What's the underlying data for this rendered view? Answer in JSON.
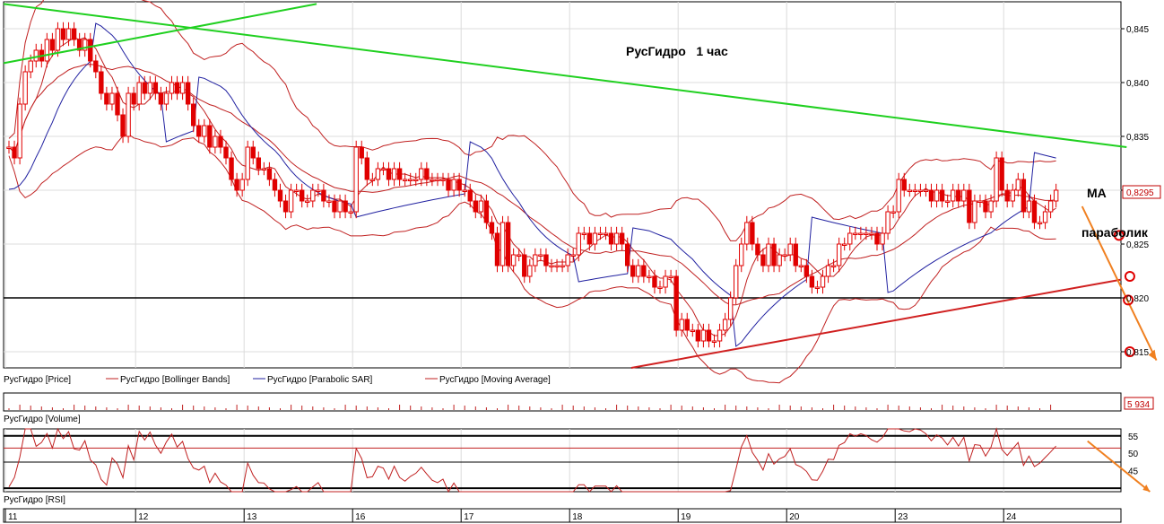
{
  "colors": {
    "candle": "#e00000",
    "bollinger": "#c02020",
    "psar": "#2020a0",
    "ma": "#c02020",
    "trend_green": "#20d020",
    "trend_red": "#d02020",
    "forecast_arrow": "#f08020",
    "grid": "#dcdcdc"
  },
  "chart_data": {
    "type": "line",
    "title": "РусГидро   1 час",
    "legend": [
      "РусГидро [Price]",
      "РусГидро [Bollinger Bands]",
      "РусГидро [Parabolic SAR]",
      "РусГидро [Moving Average]"
    ],
    "price_axis": {
      "ylim": [
        0.8135,
        0.8475
      ],
      "ticks": [
        "0,845",
        "0,840",
        "0,835",
        "0,830",
        "0,825",
        "0,820",
        "0,815"
      ]
    },
    "last_price_label": "0,8295",
    "dates": [
      {
        "label": "11",
        "bar": 0
      },
      {
        "label": "12",
        "bar": 24
      },
      {
        "label": "13",
        "bar": 44
      },
      {
        "label": "16",
        "bar": 64
      },
      {
        "label": "17",
        "bar": 84
      },
      {
        "label": "18",
        "bar": 104
      },
      {
        "label": "19",
        "bar": 124
      },
      {
        "label": "20",
        "bar": 144
      },
      {
        "label": "23",
        "bar": 164
      },
      {
        "label": "24",
        "bar": 184
      }
    ],
    "close": [
      0.834,
      0.833,
      0.838,
      0.841,
      0.842,
      0.843,
      0.842,
      0.844,
      0.843,
      0.845,
      0.844,
      0.845,
      0.844,
      0.843,
      0.844,
      0.842,
      0.841,
      0.839,
      0.838,
      0.839,
      0.837,
      0.835,
      0.839,
      0.838,
      0.84,
      0.839,
      0.84,
      0.839,
      0.838,
      0.839,
      0.84,
      0.839,
      0.84,
      0.838,
      0.836,
      0.835,
      0.836,
      0.834,
      0.835,
      0.834,
      0.833,
      0.831,
      0.83,
      0.831,
      0.834,
      0.833,
      0.832,
      0.832,
      0.831,
      0.83,
      0.829,
      0.828,
      0.83,
      0.83,
      0.829,
      0.829,
      0.83,
      0.83,
      0.829,
      0.829,
      0.828,
      0.829,
      0.828,
      0.828,
      0.834,
      0.833,
      0.831,
      0.831,
      0.832,
      0.832,
      0.831,
      0.832,
      0.831,
      0.831,
      0.831,
      0.831,
      0.832,
      0.831,
      0.831,
      0.831,
      0.831,
      0.83,
      0.831,
      0.83,
      0.83,
      0.829,
      0.828,
      0.829,
      0.827,
      0.826,
      0.823,
      0.827,
      0.823,
      0.824,
      0.824,
      0.822,
      0.823,
      0.824,
      0.824,
      0.823,
      0.823,
      0.823,
      0.823,
      0.824,
      0.824,
      0.826,
      0.826,
      0.825,
      0.826,
      0.826,
      0.826,
      0.825,
      0.826,
      0.825,
      0.823,
      0.822,
      0.823,
      0.822,
      0.822,
      0.821,
      0.821,
      0.822,
      0.822,
      0.817,
      0.818,
      0.817,
      0.817,
      0.816,
      0.817,
      0.816,
      0.816,
      0.817,
      0.818,
      0.82,
      0.823,
      0.825,
      0.827,
      0.825,
      0.824,
      0.823,
      0.825,
      0.823,
      0.824,
      0.824,
      0.825,
      0.823,
      0.823,
      0.822,
      0.821,
      0.821,
      0.822,
      0.823,
      0.823,
      0.825,
      0.825,
      0.826,
      0.826,
      0.826,
      0.826,
      0.826,
      0.825,
      0.826,
      0.828,
      0.828,
      0.831,
      0.83,
      0.83,
      0.83,
      0.83,
      0.83,
      0.829,
      0.83,
      0.829,
      0.829,
      0.83,
      0.829,
      0.83,
      0.827,
      0.829,
      0.829,
      0.828,
      0.829,
      0.833,
      0.83,
      0.829,
      0.83,
      0.831,
      0.828,
      0.829,
      0.827,
      0.827,
      0.828,
      0.829,
      0.83
    ],
    "rsi_axis": {
      "ylim": [
        39,
        57
      ],
      "ticks": [
        "55",
        "50",
        "45"
      ],
      "bands": [
        55,
        51.5,
        47.5,
        40
      ]
    },
    "rsi": [
      40.4,
      43.1,
      48.9,
      57.3,
      57.5,
      52.0,
      53.1,
      55.7,
      51.5,
      58.2,
      54.2,
      56.2,
      51.3,
      50.9,
      53.6,
      48.1,
      46.7,
      42.5,
      40.9,
      48.7,
      46.9,
      43.0,
      52.2,
      48.1,
      56.3,
      53.8,
      56.1,
      52.4,
      50.0,
      53.2,
      55.5,
      51.8,
      53.4,
      48.5,
      45.8,
      45.2,
      46.3,
      41.6,
      44.3,
      41.8,
      40.9,
      37.8,
      36.8,
      38.9,
      47.2,
      43.7,
      41.6,
      41.5,
      39.8,
      37.0,
      36.0,
      35.1,
      39.6,
      40.5,
      37.4,
      38.4,
      40.4,
      41.6,
      38.9,
      37.2,
      35.9,
      39.0,
      36.1,
      36.8,
      51.4,
      48.5,
      43.0,
      43.3,
      46.3,
      45.8,
      42.6,
      46.3,
      43.1,
      42.0,
      43.4,
      44.3,
      46.0,
      44.1,
      42.3,
      41.6,
      42.6,
      38.7,
      41.5,
      38.3,
      38.6,
      36.5,
      35.9,
      38.7,
      34.6,
      31.2,
      26.3,
      36.4,
      30.0,
      32.0,
      32.0,
      29.5,
      32.1,
      33.8,
      34.3,
      31.6,
      31.6,
      32.1,
      33.6,
      36.0,
      36.4,
      41.0,
      41.0,
      38.3,
      40.6,
      40.6,
      40.6,
      37.9,
      40.7,
      39.0,
      34.7,
      32.1,
      35.0,
      32.2,
      33.2,
      30.8,
      31.7,
      33.3,
      33.9,
      25.7,
      28.6,
      27.1,
      27.6,
      26.3,
      28.4,
      27.1,
      27.2,
      30.6,
      32.8,
      39.3,
      45.5,
      51.9,
      55.1,
      50.3,
      48.0,
      45.2,
      49.9,
      46.9,
      48.4,
      49.1,
      51.3,
      46.8,
      46.1,
      44.8,
      42.4,
      42.3,
      44.9,
      48.3,
      48.2,
      52.3,
      53.1,
      55.6,
      54.9,
      55.6,
      55.1,
      53.9,
      53.2,
      54.5,
      58.5,
      57.4,
      61.8,
      56.4,
      56.2,
      57.0,
      56.7,
      55.6,
      53.6,
      55.3,
      54.4,
      52.4,
      54.6,
      52.1,
      54.6,
      47.8,
      52.5,
      52.3,
      49.2,
      51.7,
      59.5,
      51.1,
      49.4,
      51.3,
      53.1,
      46.5,
      49.2,
      46.2,
      47.2,
      48.8,
      50.4,
      52.1
    ],
    "volume_label": "5 934",
    "panels": {
      "price": "РусГидро [Price]",
      "volume": "РусГидро [Volume]",
      "rsi": "РусГидро [RSI]"
    },
    "annotations": [
      {
        "text": "MA"
      },
      {
        "text": "параболик"
      }
    ]
  }
}
